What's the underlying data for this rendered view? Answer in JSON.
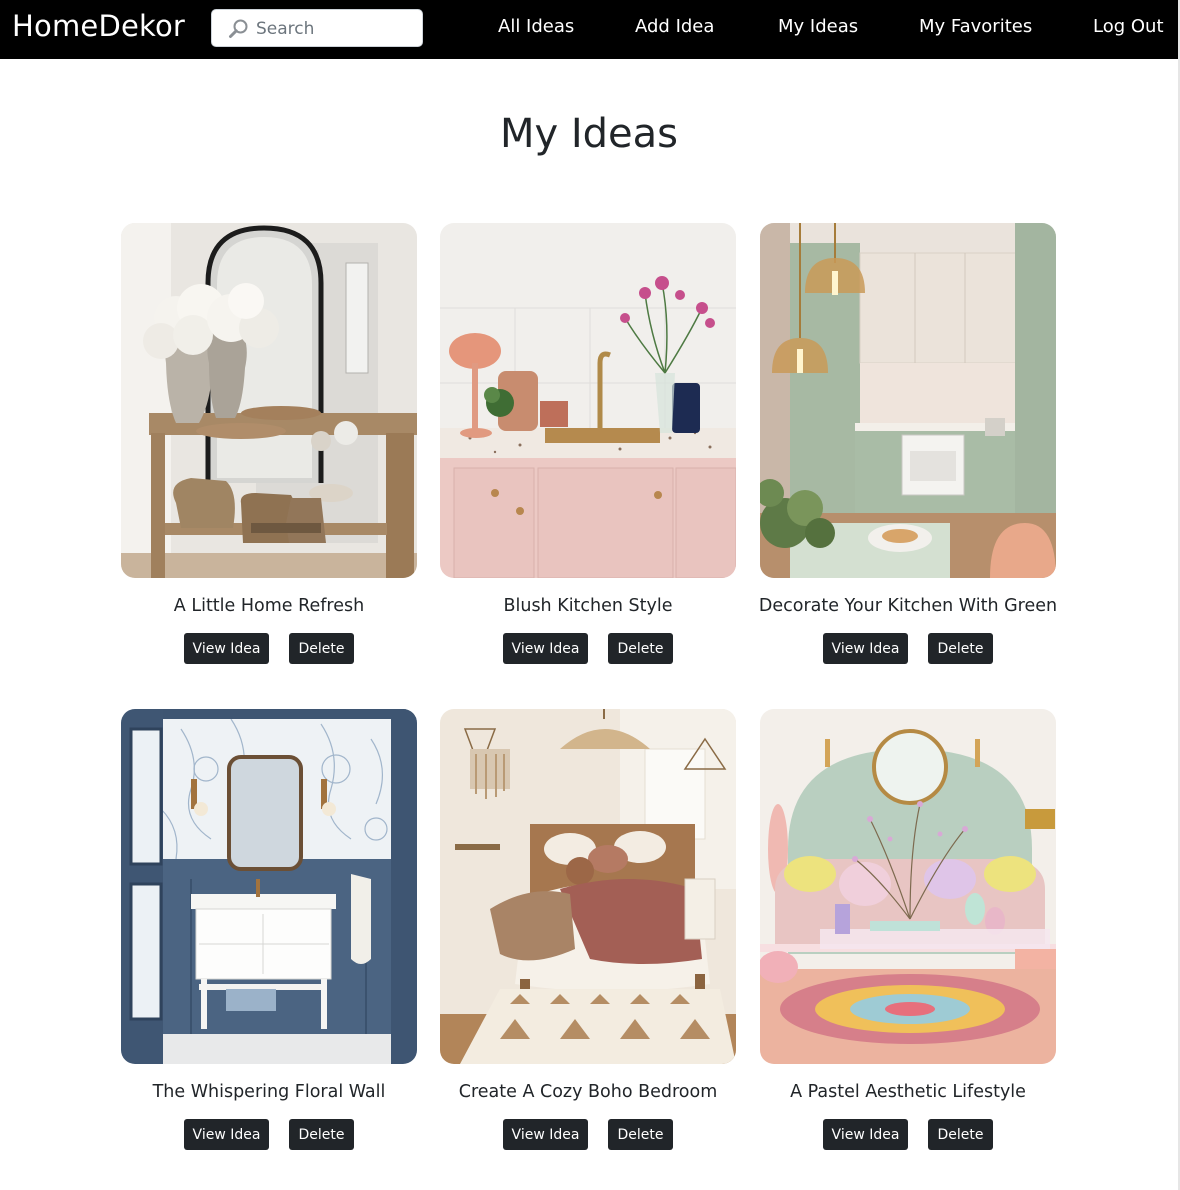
{
  "navbar": {
    "brand": "HomeDekor",
    "search_placeholder": "Search",
    "links": [
      "All Ideas",
      "Add Idea",
      "My Ideas",
      "My Favorites",
      "Log Out"
    ]
  },
  "page": {
    "title": "My Ideas"
  },
  "ideas": [
    {
      "title": "A Little Home Refresh",
      "view_label": "View Idea",
      "delete_label": "Delete"
    },
    {
      "title": "Blush Kitchen Style",
      "view_label": "View Idea",
      "delete_label": "Delete"
    },
    {
      "title": "Decorate Your Kitchen With Green",
      "view_label": "View Idea",
      "delete_label": "Delete"
    },
    {
      "title": "The Whispering Floral Wall",
      "view_label": "View Idea",
      "delete_label": "Delete"
    },
    {
      "title": "Create A Cozy Boho Bedroom",
      "view_label": "View Idea",
      "delete_label": "Delete"
    },
    {
      "title": "A Pastel Aesthetic Lifestyle",
      "view_label": "View Idea",
      "delete_label": "Delete"
    }
  ]
}
